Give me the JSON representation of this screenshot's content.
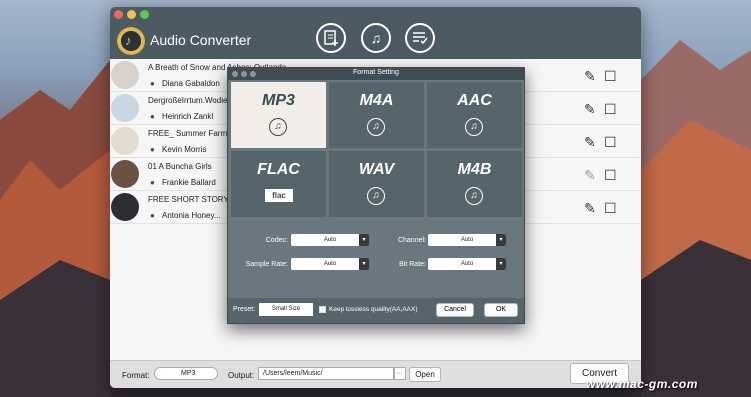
{
  "app": {
    "title": "Audio Converter"
  },
  "toolbar": {
    "add_files_icon": "add-file-icon",
    "add_music_icon": "add-music-icon",
    "history_icon": "list-check-icon"
  },
  "tracks": [
    {
      "title": "A Breath of Snow and Ashes: Outlande",
      "author": "Diana Gabaldon"
    },
    {
      "title": "DergroßeIrrtum.Wodie",
      "author": "Heinrich Zankl"
    },
    {
      "title": "FREE_ Summer Farmer",
      "author": "Kevin Morris"
    },
    {
      "title": "01 A Buncha Girls",
      "author": "Frankie Ballard"
    },
    {
      "title": "FREE SHORT STORY_",
      "author": "Antonia Honey..."
    }
  ],
  "dialog": {
    "title": "Format Setting",
    "formats": [
      {
        "name": "MP3",
        "selected": true
      },
      {
        "name": "M4A",
        "selected": false
      },
      {
        "name": "AAC",
        "selected": false
      },
      {
        "name": "FLAC",
        "selected": false,
        "tag": "flac"
      },
      {
        "name": "WAV",
        "selected": false
      },
      {
        "name": "M4B",
        "selected": false
      }
    ],
    "codec_label": "Codec:",
    "codec_value": "Auto",
    "channel_label": "Channel:",
    "channel_value": "Auto",
    "sample_rate_label": "Sample Rate:",
    "sample_rate_value": "Auto",
    "bit_rate_label": "Bit Rate:",
    "bit_rate_value": "Auto",
    "preset_label": "Preset:",
    "preset_value": "Small Size",
    "lossless_label": "Keep lossless quality(AA,AAX)",
    "cancel_label": "Cancel",
    "ok_label": "OK"
  },
  "bottom": {
    "format_label": "Format:",
    "format_value": "MP3",
    "output_label": "Output:",
    "output_value": "/Users/leem/Music/",
    "browse_label": "···",
    "open_label": "Open",
    "convert_label": "Convert"
  },
  "watermark": "www.mac-gm.com",
  "colors": {
    "titlebar": "#4c5a63",
    "dialog": "#6a777e",
    "selected_format": "#f1eeea"
  }
}
